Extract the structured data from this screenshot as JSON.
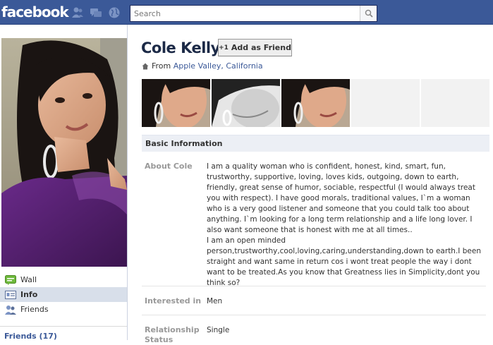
{
  "header": {
    "logo": "facebook",
    "search_placeholder": "Search"
  },
  "sidebar": {
    "nav": [
      {
        "label": "Wall",
        "icon": "wall-icon"
      },
      {
        "label": "Info",
        "icon": "info-icon",
        "active": true
      },
      {
        "label": "Friends",
        "icon": "friends-icon"
      }
    ],
    "friends_heading": "Friends (17)"
  },
  "profile": {
    "name": "Cole Kelly",
    "add_friend_label": "Add as Friend",
    "from_prefix": "From",
    "from_location": "Apple Valley, California"
  },
  "info": {
    "section_title": "Basic Information",
    "about_label": "About Cole",
    "about_text": "I am a quality woman who is confident, honest, kind, smart, fun, trustworthy, supportive, loving, loves kids, outgoing, down to earth, friendly, great sense of humor, sociable, respectful (I would always treat you with respect). I have good morals, traditional values, I`m a woman who is a very good listener and someone that you could talk too about anything. I`m looking for a long term relationship and a life long lover. I also want someone that is honest with me at all times..",
    "about_text_2": "I am an open minded person,trustworthy,cool,loving,caring,understanding,down to earth.I been straight and want same in return cos i wont treat people the way i dont want to be treated.As you know that Greatness lies in Simplicity,dont you think so?",
    "interested_label": "Interested in",
    "interested_value": "Men",
    "relationship_label": "Relationship Status",
    "relationship_value": "Single"
  },
  "colors": {
    "brand": "#3b5998",
    "link": "#3b5998",
    "section_bg": "#eceff5"
  }
}
